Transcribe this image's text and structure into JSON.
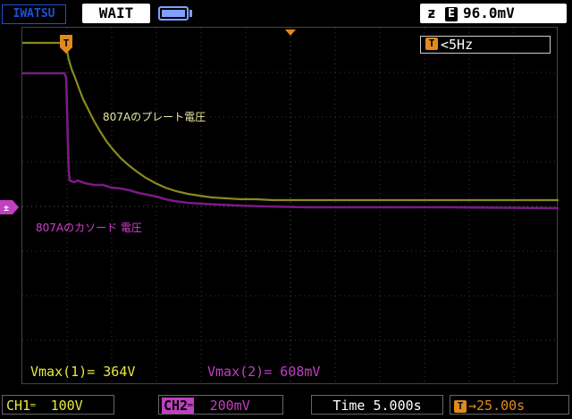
{
  "header": {
    "brand": "IWATSU",
    "status": "WAIT",
    "trigger_edge_symbol": "ƶ",
    "trigger_source_symbol": "E",
    "trigger_level": "96.0mV"
  },
  "frequency_counter": {
    "icon": "T",
    "value": "<5Hz"
  },
  "traces": [
    {
      "name": "807Aのプレート電圧",
      "color": "#8a8a1e"
    },
    {
      "name": "807Aのカソード 電圧",
      "color": "#7a1a86"
    }
  ],
  "measurements": {
    "vmax1": "Vmax(1)= 364V",
    "vmax2": "Vmax(2)= 608mV"
  },
  "bottom": {
    "ch1_label": "CH1",
    "ch1_coupling": "═",
    "ch1_scale": "100V",
    "ch2_label": "CH2",
    "ch2_coupling": "═",
    "ch2_scale": "200mV",
    "time_label": "Time 5.000s",
    "delay_icon": "T",
    "delay_value": "→25.00s"
  },
  "markers": {
    "trigger_marker": "T",
    "ground_marker": "±"
  },
  "colors": {
    "ch1": "#e8e840",
    "ch2": "#c040c0",
    "trigger": "#e08a1e",
    "grid": "#3a3a3a"
  }
}
